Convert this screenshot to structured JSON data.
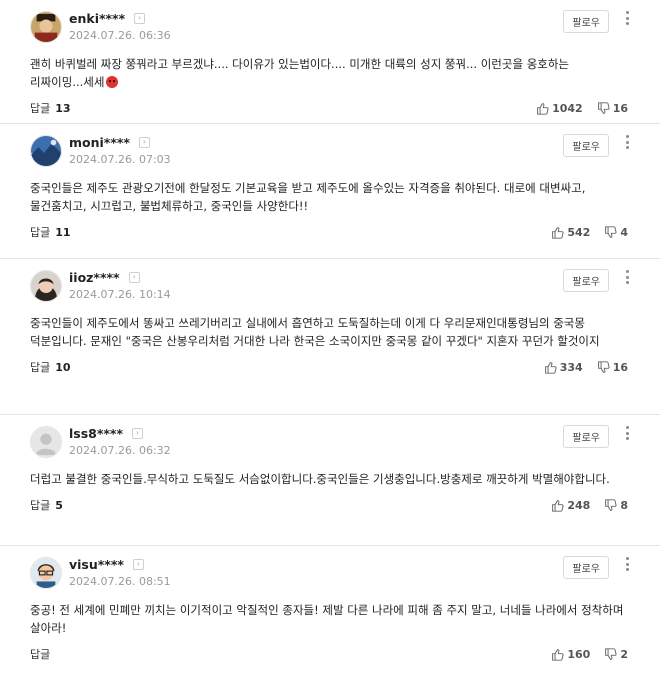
{
  "ui": {
    "reply_label": "답글",
    "follow_label": "팔로우",
    "arrow_glyph": "›"
  },
  "comments": [
    {
      "user": "enki****",
      "date": "2024.07.26. 06:36",
      "text": "괜히 바퀴벌레 짜장 쭝꿔라고 부르겠냐.... 다이유가 있는법이다.... 미개한 대륙의 성지 쭝꿔... 이런곳을 옹호하는 리짜이밍...세세",
      "emoji": "angry-face",
      "replies": "13",
      "likes": "1042",
      "dislikes": "16",
      "avatar": "portrait-man-hat"
    },
    {
      "user": "moni****",
      "date": "2024.07.26. 07:03",
      "text": "중국인들은 제주도 관광오기전에 한달정도 기본교육을 받고 제주도에 올수있는 자격증을 취야된다. 대로에 대변싸고, 물건훔치고, 시끄럽고, 불법체류하고, 중국인들 사양한다!!",
      "replies": "11",
      "likes": "542",
      "dislikes": "4",
      "avatar": "landscape"
    },
    {
      "user": "iioz****",
      "date": "2024.07.26. 10:14",
      "text": "중국인들이 제주도에서 똥싸고 쓰레기버리고 실내에서 흡연하고 도둑질하는데 이게 다 우리문재인대통령님의 중국몽 덕분입니다. 문재인 \"중국은 산봉우리처럼 거대한 나라 한국은 소국이지만 중국몽 같이 꾸겠다\" 지혼자 꾸던가 할것이지",
      "replies": "10",
      "likes": "334",
      "dislikes": "16",
      "avatar": "portrait-woman"
    },
    {
      "user": "lss8****",
      "date": "2024.07.26. 06:32",
      "text": "더럽고 불결한 중국인들.무식하고 도둑질도 서슴없이합니다.중국인들은 기생충입니다.방충제로 깨끗하게 박멸해야합니다.",
      "replies": "5",
      "likes": "248",
      "dislikes": "8",
      "avatar": "default-user"
    },
    {
      "user": "visu****",
      "date": "2024.07.26. 08:51",
      "text": "중공! 전 세계에 민폐만 끼치는 이기적이고 악질적인 종자들! 제발 다른 나라에 피해 좀 주지 말고, 너네들 나라에서 정착하며 살아라!",
      "replies": "",
      "likes": "160",
      "dislikes": "2",
      "avatar": "cartoon-man-glasses"
    }
  ],
  "icons": {
    "like": "thumbs-up-icon",
    "dislike": "thumbs-down-icon",
    "more": "more-vertical-icon"
  },
  "colors": {
    "border": "#e4e4e4",
    "muted": "#9a9a9a",
    "emoji": "#e0312e"
  }
}
